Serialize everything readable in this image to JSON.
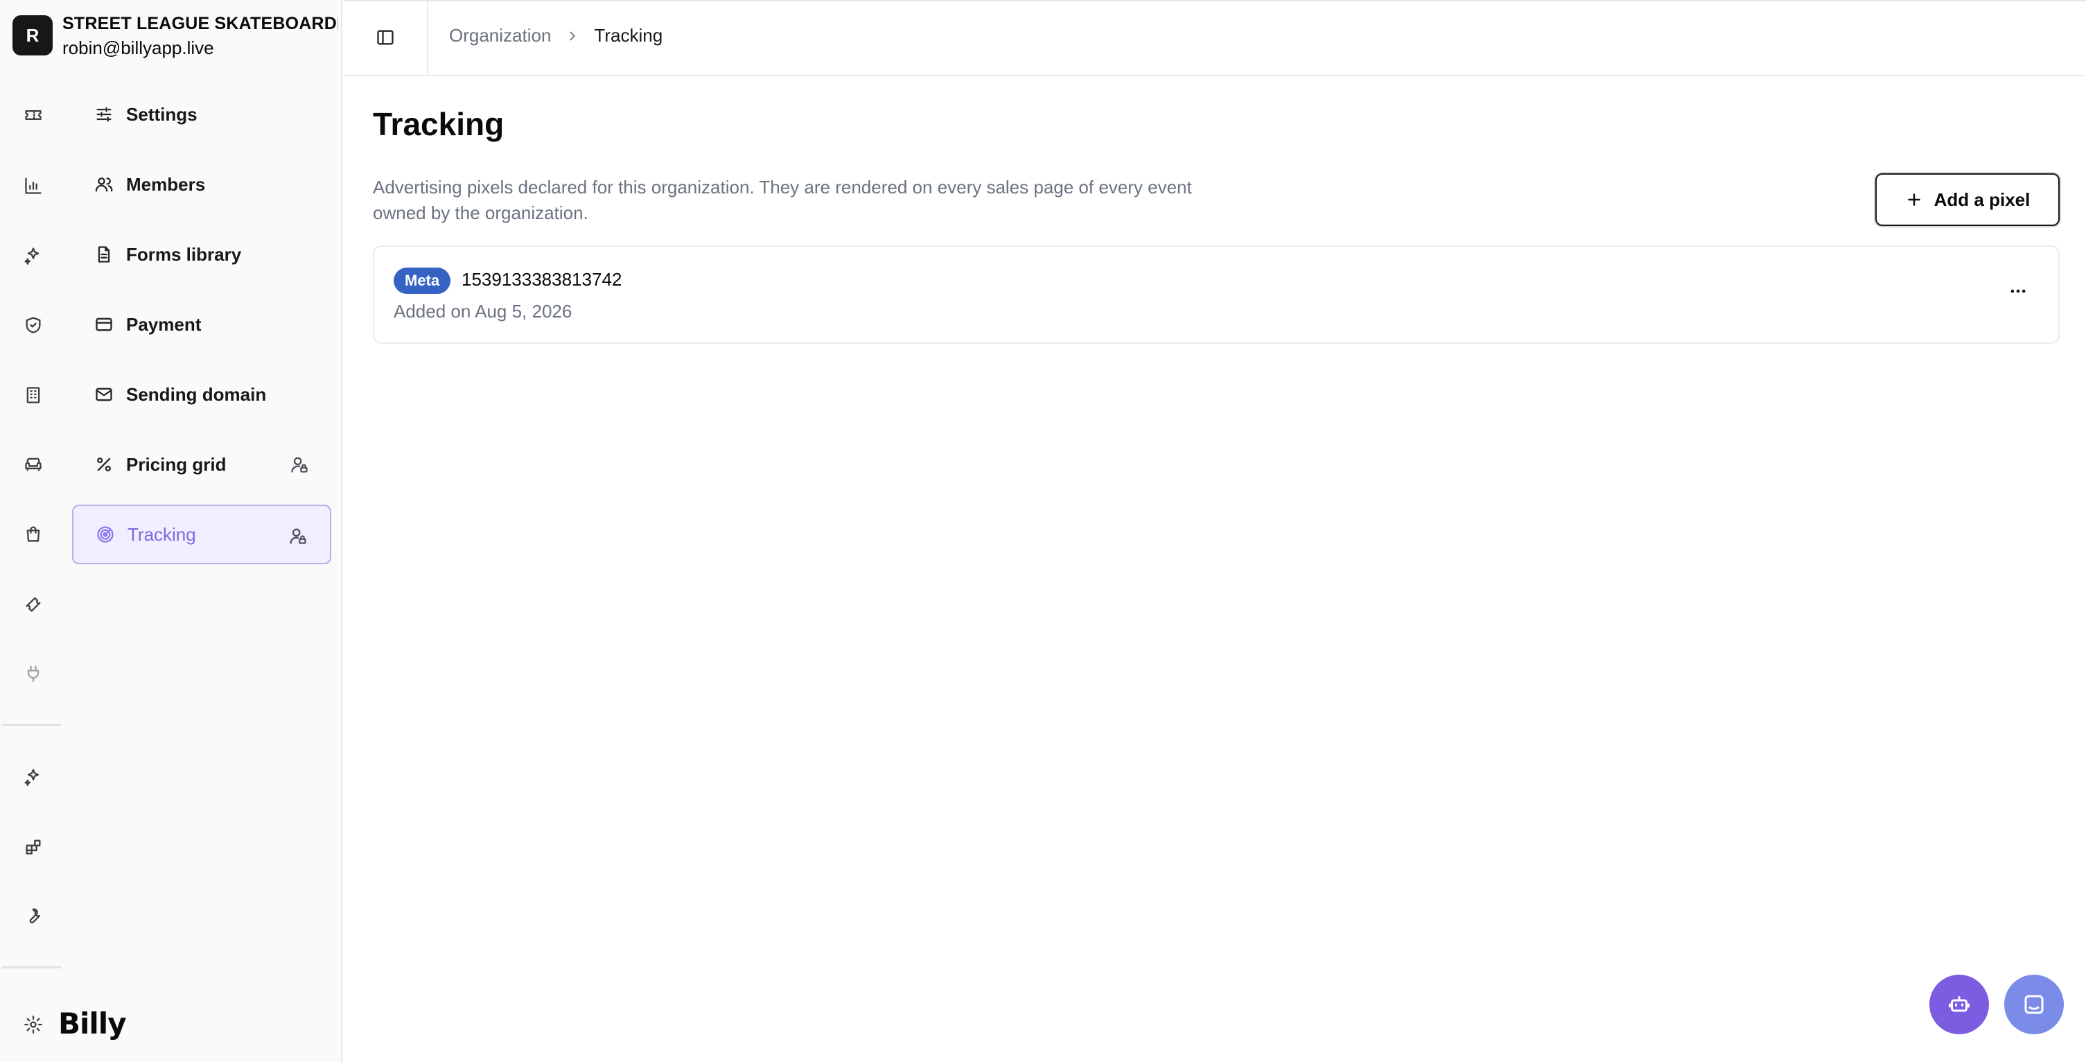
{
  "organization": {
    "avatar_letter": "R",
    "name": "STREET LEAGUE SKATEBOARDING",
    "email": "robin@billyapp.live"
  },
  "rail": {
    "icons": [
      "ticket-icon",
      "bar-chart-icon",
      "sparkles-icon",
      "shield-check-icon",
      "building-icon",
      "sofa-icon",
      "shopping-bag-icon",
      "ticket-alt-icon",
      "plug-icon",
      "sparkles-alt-icon",
      "blocks-icon",
      "wrench-icon",
      "gear-icon"
    ]
  },
  "nav": {
    "items": [
      {
        "label": "Settings",
        "icon": "sliders-icon"
      },
      {
        "label": "Members",
        "icon": "users-icon"
      },
      {
        "label": "Forms library",
        "icon": "document-icon"
      },
      {
        "label": "Payment",
        "icon": "credit-card-icon"
      },
      {
        "label": "Sending domain",
        "icon": "mail-icon"
      },
      {
        "label": "Pricing grid",
        "icon": "percent-icon",
        "admin": true
      },
      {
        "label": "Tracking",
        "icon": "radar-icon",
        "admin": true,
        "active": true
      }
    ]
  },
  "brand": {
    "logo_text": "Billy"
  },
  "breadcrumb": {
    "parent": "Organization",
    "current": "Tracking"
  },
  "page": {
    "title": "Tracking",
    "description": "Advertising pixels declared for this organization. They are rendered on every sales page of every event owned by the organization.",
    "add_button_label": "Add a pixel"
  },
  "pixels": [
    {
      "provider": "Meta",
      "pixel_id": "1539133383813742",
      "added_on": "Added on Aug 5, 2026"
    }
  ],
  "colors": {
    "active_accent": "#7c6ce0",
    "meta_badge": "#3563c4",
    "fab_bot": "#7c5ce0",
    "fab_chat": "#7b8ce8"
  }
}
